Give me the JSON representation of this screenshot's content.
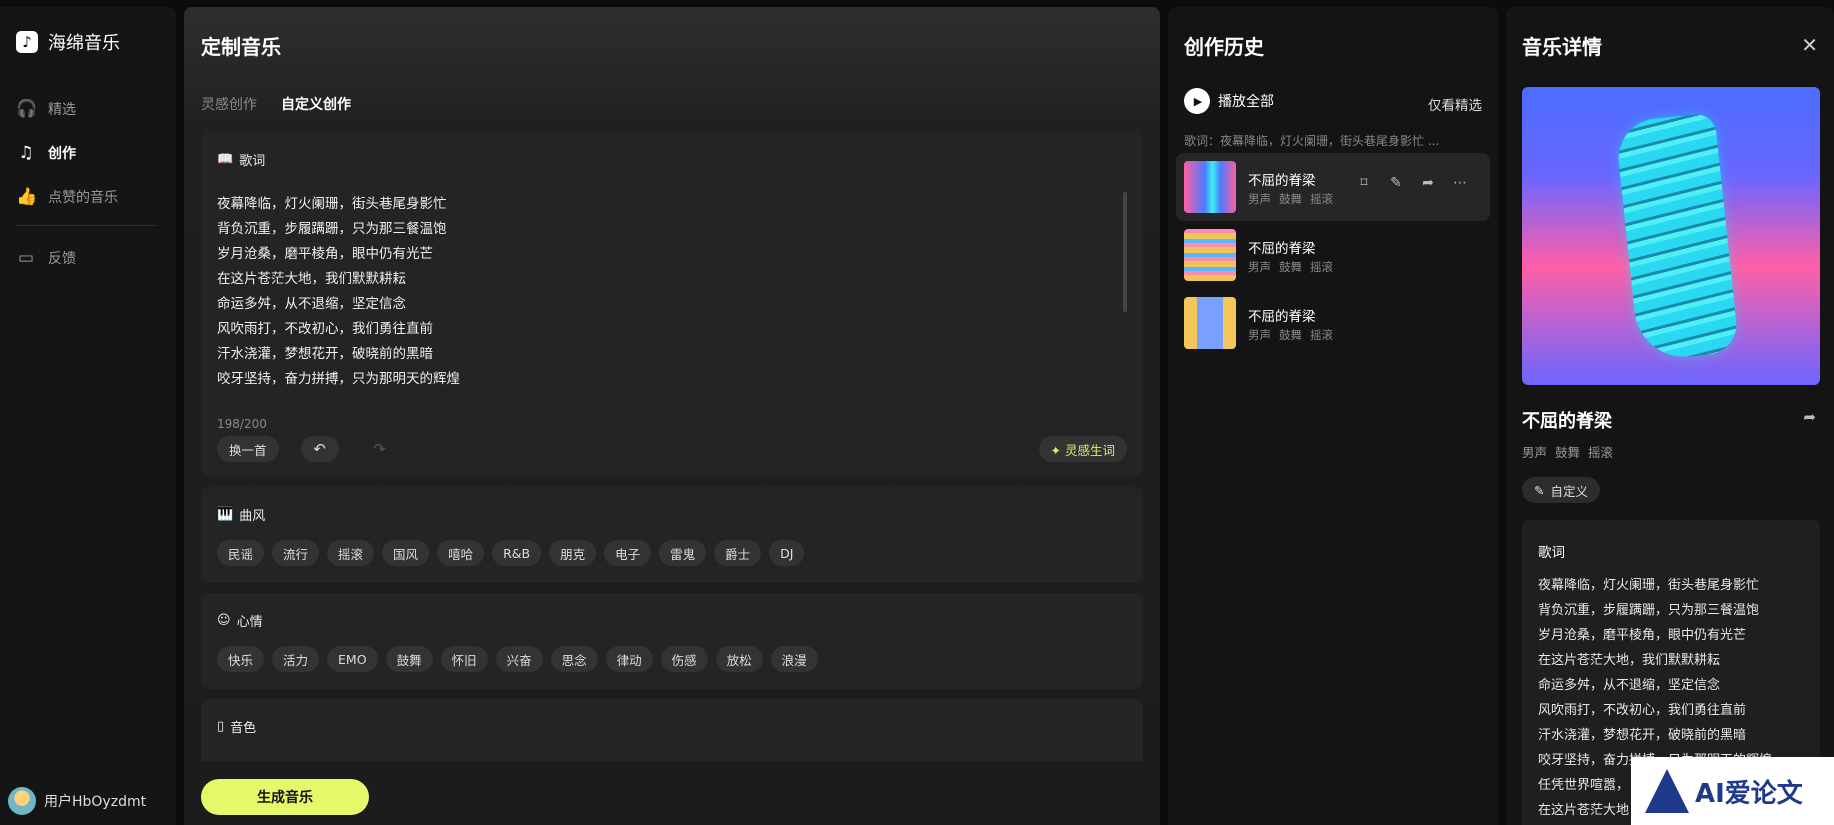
{
  "sidebar": {
    "brand_name": "海绵音乐",
    "logo_glyph": "♪",
    "nav": [
      {
        "label": "精选",
        "icon": "headphones-icon",
        "glyph": "🎧"
      },
      {
        "label": "创作",
        "icon": "music-note-icon",
        "glyph": "♫"
      },
      {
        "label": "点赞的音乐",
        "icon": "thumbs-up-icon",
        "glyph": "👍"
      },
      {
        "label": "反馈",
        "icon": "feedback-icon",
        "glyph": "▭"
      }
    ],
    "user_name": "用户HbOyzdmt"
  },
  "main": {
    "title": "定制音乐",
    "tabs": [
      "灵感创作",
      "自定义创作"
    ],
    "lyrics": {
      "title": "歌词",
      "icon_glyph": "📖",
      "lines": [
        "夜幕降临，灯火阑珊，街头巷尾身影忙",
        "背负沉重，步履蹒跚，只为那三餐温饱",
        "岁月沧桑，磨平棱角，眼中仍有光芒",
        "在这片苍茫大地，我们默默耕耘",
        "命运多舛，从不退缩，坚定信念",
        "风吹雨打，不改初心，我们勇往直前",
        "汗水浇灌，梦想花开，破晓前的黑暗",
        "咬牙坚持，奋力拼搏，只为那明天的辉煌"
      ],
      "counter": "198/200",
      "swap_label": "换一首",
      "undo_glyph": "↶",
      "redo_glyph": "↷",
      "inspire_label": "✦ 灵感生词"
    },
    "style": {
      "title": "曲风",
      "icon_glyph": "🎹",
      "tags": [
        "民谣",
        "流行",
        "摇滚",
        "国风",
        "嘻哈",
        "R&B",
        "朋克",
        "电子",
        "雷鬼",
        "爵士",
        "DJ"
      ]
    },
    "mood": {
      "title": "心情",
      "icon_glyph": "☺",
      "tags": [
        "快乐",
        "活力",
        "EMO",
        "鼓舞",
        "怀旧",
        "兴奋",
        "思念",
        "律动",
        "伤感",
        "放松",
        "浪漫"
      ]
    },
    "timbre": {
      "title": "音色",
      "icon_glyph": "▯"
    },
    "generate_label": "生成音乐"
  },
  "history": {
    "title": "创作历史",
    "play_all_label": "播放全部",
    "filter_label": "仅看精选",
    "lyric_preview": "歌词：夜幕降临，灯火阑珊，街头巷尾身影忙 ...",
    "songs": [
      {
        "title": "不屈的脊梁",
        "tags": [
          "男声",
          "鼓舞",
          "摇滚"
        ]
      },
      {
        "title": "不屈的脊梁",
        "tags": [
          "男声",
          "鼓舞",
          "摇滚"
        ]
      },
      {
        "title": "不屈的脊梁",
        "tags": [
          "男声",
          "鼓舞",
          "摇滚"
        ]
      }
    ],
    "row_action_icons": [
      "bookmark-icon",
      "edit-icon",
      "share-icon",
      "more-icon"
    ]
  },
  "detail": {
    "title": "音乐详情",
    "song_title": "不屈的脊梁",
    "tags": [
      "男声",
      "鼓舞",
      "摇滚"
    ],
    "custom_label": "自定义",
    "lyrics_title": "歌词",
    "lyrics_lines": [
      "夜幕降临，灯火阑珊，街头巷尾身影忙",
      "背负沉重，步履蹒跚，只为那三餐温饱",
      "岁月沧桑，磨平棱角，眼中仍有光芒",
      "在这片苍茫大地，我们默默耕耘",
      "命运多舛，从不退缩，坚定信念",
      "风吹雨打，不改初心，我们勇往直前",
      "汗水浇灌，梦想花开，破晓前的黑暗",
      "咬牙坚持，奋力拼搏，只为那明天的辉煌",
      "任凭世界喧嚣，",
      "在这片苍茫大地"
    ]
  },
  "watermark": {
    "text": "AI爱论文"
  },
  "colors": {
    "accent": "#e6f86a",
    "background": "#0c0c0c",
    "panel": "#141414"
  }
}
